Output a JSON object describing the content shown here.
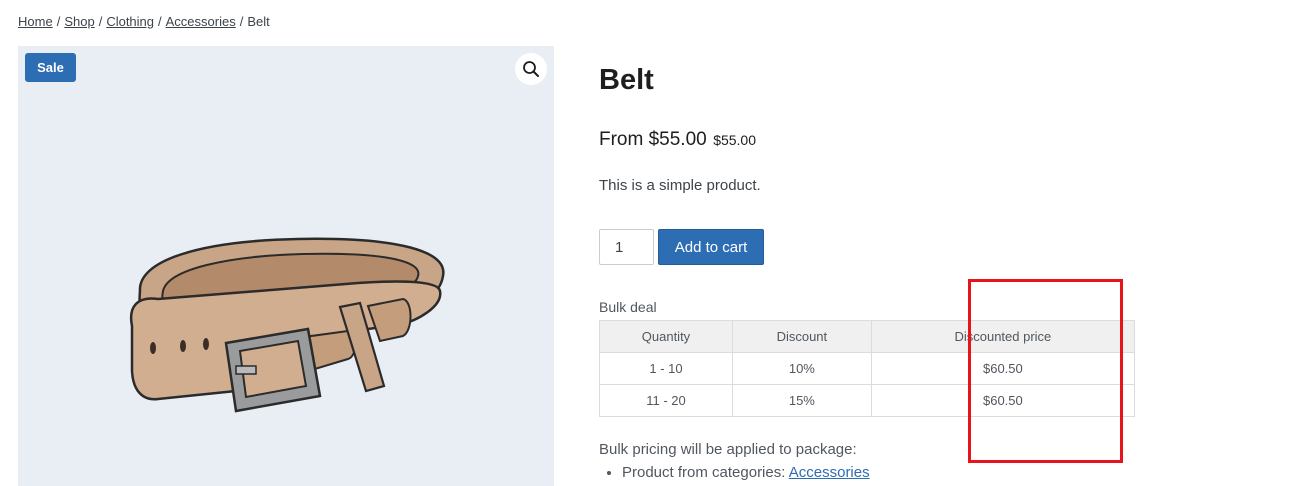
{
  "breadcrumb": {
    "items": [
      {
        "label": "Home"
      },
      {
        "label": "Shop"
      },
      {
        "label": "Clothing"
      },
      {
        "label": "Accessories"
      }
    ],
    "separator": "/",
    "current": "Belt"
  },
  "gallery": {
    "sale_badge": "Sale",
    "zoom_icon": "magnifier-icon",
    "image_subject": "belt"
  },
  "product": {
    "title": "Belt",
    "price_main": "From $55.00",
    "price_small": "$55.00",
    "short_description": "This is a simple product.",
    "quantity_value": "1",
    "add_to_cart_label": "Add to cart"
  },
  "bulk": {
    "label": "Bulk deal",
    "columns": [
      "Quantity",
      "Discount",
      "Discounted price"
    ],
    "rows": [
      {
        "quantity": "1 - 10",
        "discount": "10%",
        "discounted_price": "$60.50"
      },
      {
        "quantity": "11 - 20",
        "discount": "15%",
        "discounted_price": "$60.50"
      }
    ],
    "note": "Bulk pricing will be applied to package:",
    "rule_prefix": "Product from categories:",
    "rule_link": "Accessories"
  },
  "colors": {
    "accent": "#2d6db3",
    "highlight": "#e8141b",
    "gallery_bg": "#e8eef4"
  }
}
